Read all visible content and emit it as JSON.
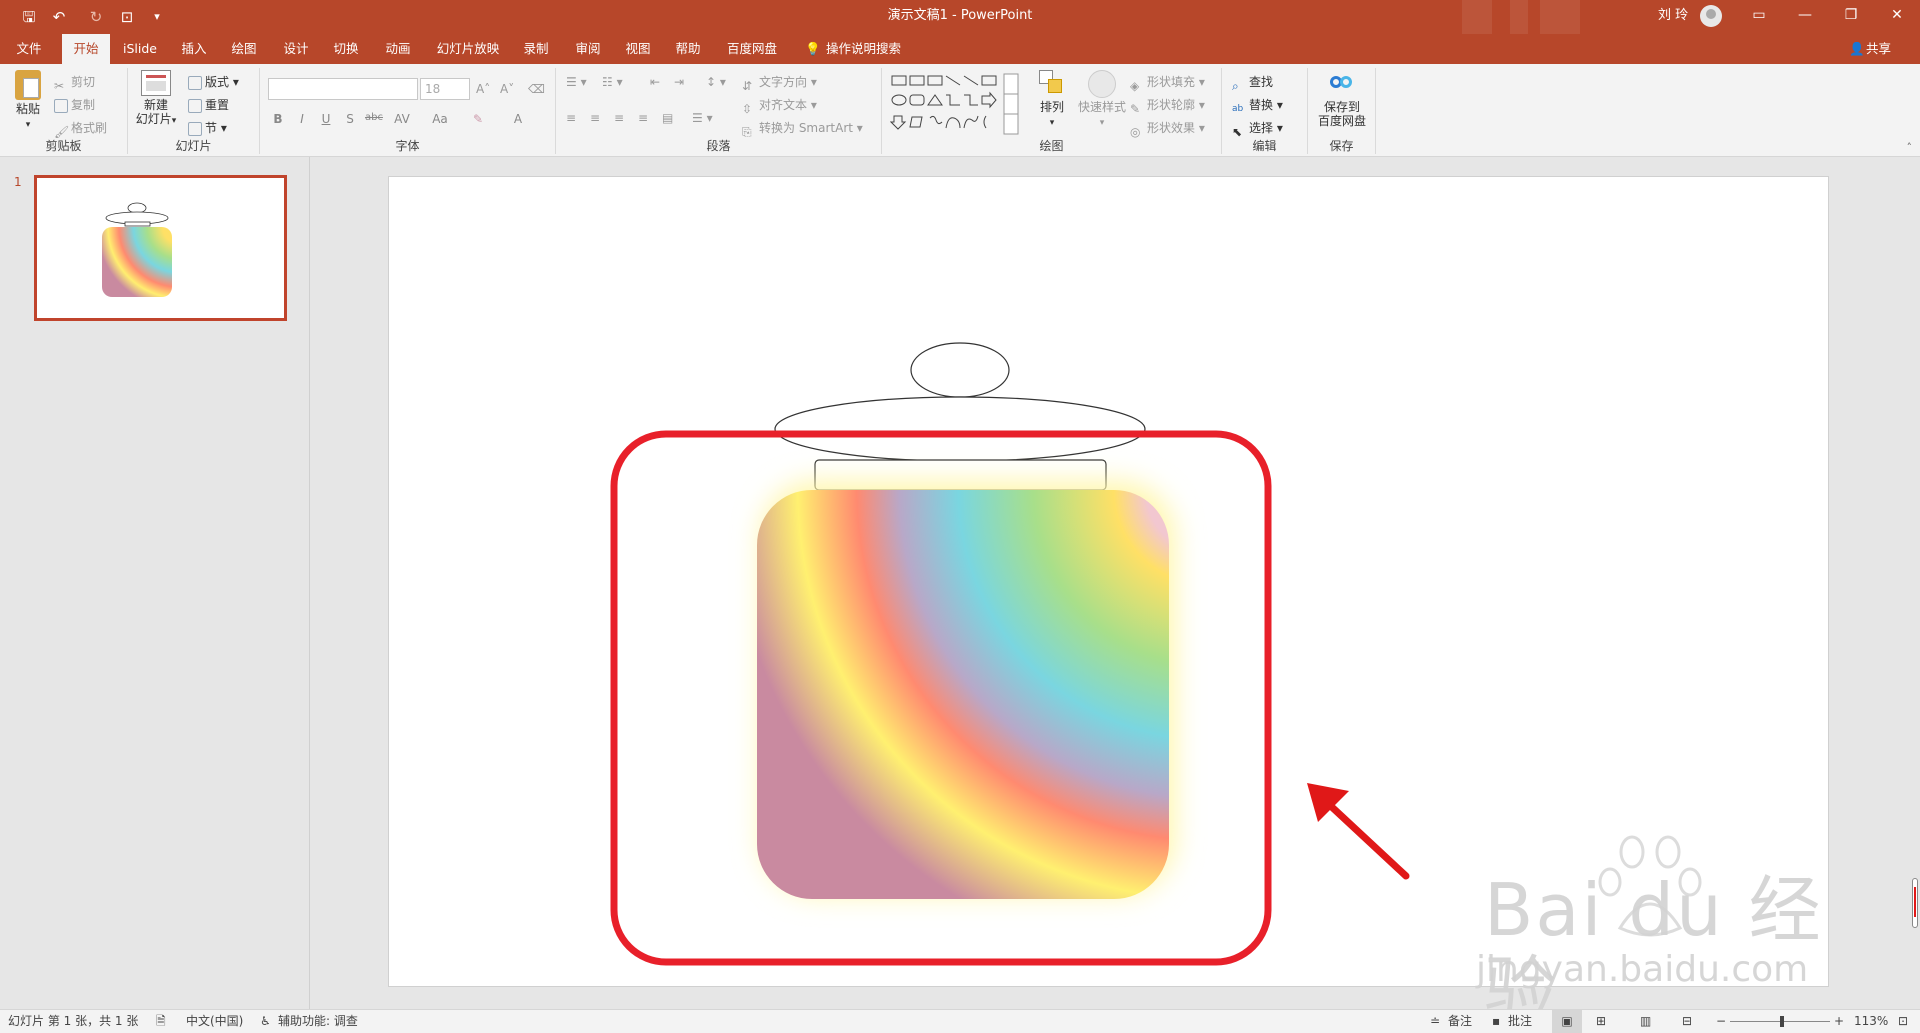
{
  "window": {
    "title": "演示文稿1 - PowerPoint",
    "user_name": "刘 玲",
    "controls": [
      "restore-ribbon",
      "minimize",
      "maximize",
      "close"
    ]
  },
  "quick_access": {
    "icons": [
      "save-icon",
      "undo-icon",
      "redo-icon",
      "presenter-icon",
      "customize-icon"
    ]
  },
  "tabs": [
    {
      "label": "文件"
    },
    {
      "label": "开始"
    },
    {
      "label": "iSlide"
    },
    {
      "label": "插入"
    },
    {
      "label": "绘图"
    },
    {
      "label": "设计"
    },
    {
      "label": "切换"
    },
    {
      "label": "动画"
    },
    {
      "label": "幻灯片放映"
    },
    {
      "label": "录制"
    },
    {
      "label": "审阅"
    },
    {
      "label": "视图"
    },
    {
      "label": "帮助"
    },
    {
      "label": "百度网盘"
    }
  ],
  "active_tab": "开始",
  "tell_me": "操作说明搜索",
  "share": "共享",
  "ribbon": {
    "clipboard": {
      "label": "剪贴板",
      "paste": "粘贴",
      "cut": "剪切",
      "copy": "复制",
      "format_painter": "格式刷"
    },
    "slides": {
      "label": "幻灯片",
      "new_slide_line1": "新建",
      "new_slide_line2": "幻灯片",
      "layout": "版式",
      "reset": "重置",
      "section": "节"
    },
    "font": {
      "label": "字体",
      "font_name": "",
      "font_size": "18",
      "bold": "B",
      "italic": "I",
      "underline": "U",
      "shadow": "S",
      "strike": "abc",
      "spacing": "AV",
      "case": "Aa",
      "color": "A"
    },
    "paragraph": {
      "label": "段落",
      "text_direction": "文字方向",
      "align_text": "对齐文本",
      "convert_smartart": "转换为 SmartArt"
    },
    "drawing": {
      "label": "绘图",
      "arrange": "排列",
      "quick_styles": "快速样式",
      "shape_fill": "形状填充",
      "shape_outline": "形状轮廓",
      "shape_effects": "形状效果"
    },
    "editing": {
      "label": "编辑",
      "find": "查找",
      "replace": "替换",
      "select": "选择"
    },
    "save": {
      "label": "保存",
      "save_to_line1": "保存到",
      "save_to_line2": "百度网盘"
    }
  },
  "thumbnails": [
    {
      "number": "1"
    }
  ],
  "statusbar": {
    "slide_info": "幻灯片 第 1 张，共 1 张",
    "language": "中文(中国)",
    "accessibility": "辅助功能: 调查",
    "notes": "备注",
    "comments": "批注",
    "zoom": "113%"
  },
  "watermark": {
    "brand": "Bai du 经验",
    "url": "jingyan.baidu.com"
  },
  "colors": {
    "accent": "#b7472a",
    "highlight_box": "#e8202a",
    "arrow": "#e01818",
    "glow": "#fff6a8"
  }
}
